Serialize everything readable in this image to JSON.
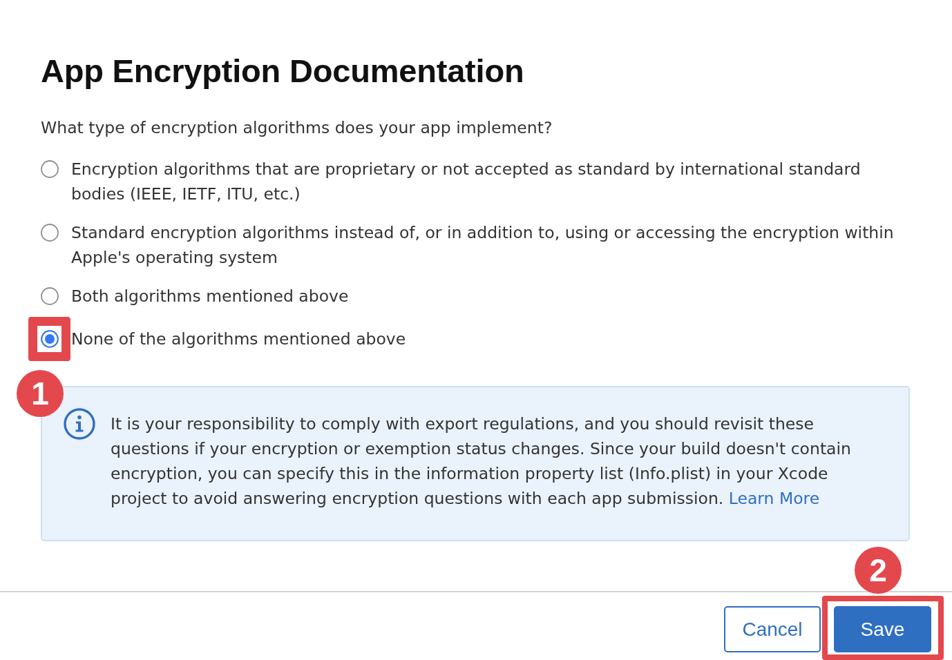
{
  "dialog": {
    "title": "App Encryption Documentation",
    "question": "What type of encryption algorithms does your app implement?",
    "options": [
      {
        "label": "Encryption algorithms that are proprietary or not accepted as standard by international standard bodies (IEEE, IETF, ITU, etc.)",
        "selected": false,
        "highlighted": false
      },
      {
        "label": "Standard encryption algorithms instead of, or in addition to, using or accessing the encryption within Apple's operating system",
        "selected": false,
        "highlighted": false
      },
      {
        "label": "Both algorithms mentioned above",
        "selected": false,
        "highlighted": false
      },
      {
        "label": "None of the algorithms mentioned above",
        "selected": true,
        "highlighted": true,
        "step": "1"
      }
    ],
    "notice": {
      "text": "It is your responsibility to comply with export regulations, and you should revisit these questions if your encryption or exemption status changes. Since your build doesn't contain encryption, you can specify this in the information property list (Info.plist) in your Xcode project to avoid answering encryption questions with each app submission.",
      "link": "Learn More"
    },
    "buttons": [
      {
        "label": "Cancel",
        "kind": "secondary",
        "highlighted": false
      },
      {
        "label": "Save",
        "kind": "primary",
        "highlighted": true,
        "step": "2"
      }
    ]
  }
}
